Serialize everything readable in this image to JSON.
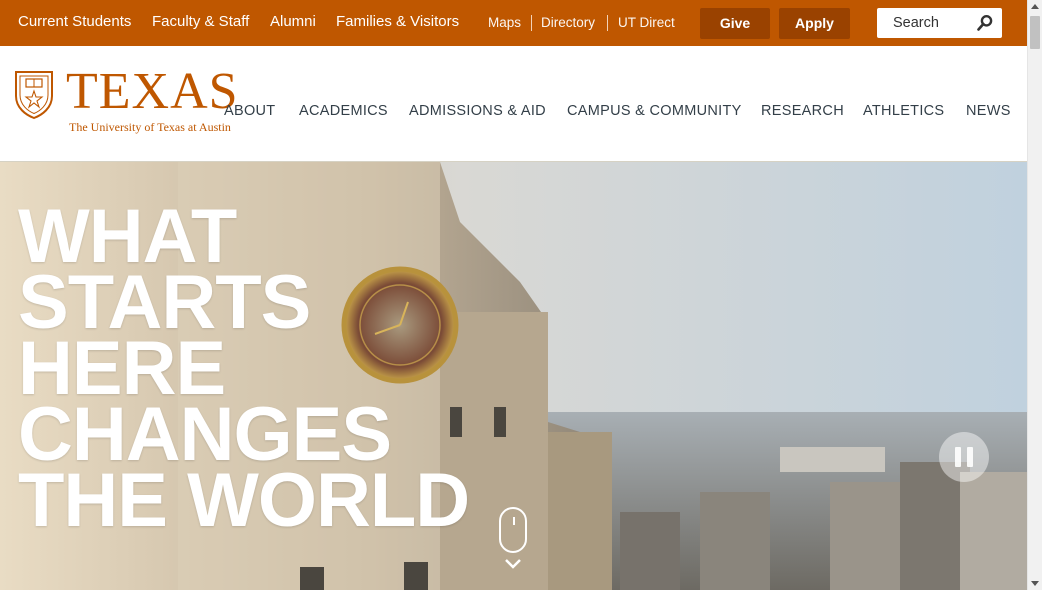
{
  "utility": {
    "audience_links": [
      "Current Students",
      "Faculty & Staff",
      "Alumni",
      "Families & Visitors"
    ],
    "quick_links": [
      "Maps",
      "Directory",
      "UT Direct"
    ],
    "give_label": "Give",
    "apply_label": "Apply",
    "search_label": "Search"
  },
  "logo": {
    "wordmark": "TEXAS",
    "subtitle": "The University of Texas at Austin"
  },
  "nav": [
    "ABOUT",
    "ACADEMICS",
    "ADMISSIONS & AID",
    "CAMPUS & COMMUNITY",
    "RESEARCH",
    "ATHLETICS",
    "NEWS"
  ],
  "hero": {
    "headline_lines": [
      "WHAT",
      "STARTS",
      "HERE",
      "CHANGES",
      "THE WORLD"
    ]
  },
  "colors": {
    "brand": "#bf5700",
    "button_dark": "#9a4200",
    "nav_text": "#333f48"
  },
  "icons": {
    "search": "search-icon",
    "pause": "pause-icon",
    "scroll": "scroll-mouse-icon"
  }
}
